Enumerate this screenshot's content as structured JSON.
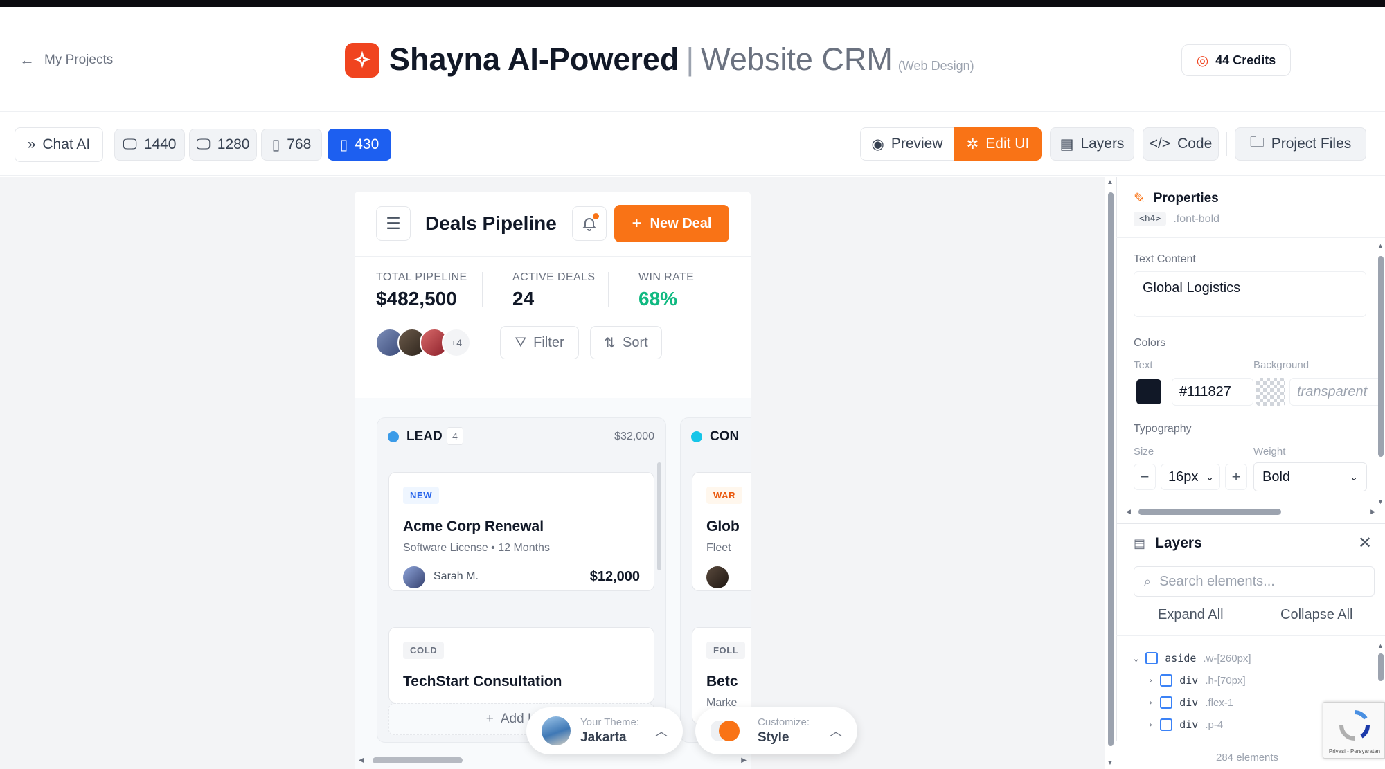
{
  "header": {
    "back_label": "My Projects",
    "title_main": "Shayna AI-Powered",
    "title_sep": "|",
    "title_sub": "Website CRM",
    "title_tag": "(Web Design)",
    "credits": "44 Credits"
  },
  "toolbar": {
    "chat": "Chat AI",
    "sizes": [
      "1440",
      "1280",
      "768",
      "430"
    ],
    "active_size": "430",
    "preview": "Preview",
    "edit": "Edit UI",
    "layers": "Layers",
    "code": "Code",
    "files": "Project Files"
  },
  "phone": {
    "title": "Deals Pipeline",
    "new_deal": "New Deal",
    "stats": [
      {
        "label": "TOTAL PIPELINE",
        "value": "$482,500"
      },
      {
        "label": "ACTIVE DEALS",
        "value": "24"
      },
      {
        "label": "WIN RATE",
        "value": "68%"
      }
    ],
    "avatars_more": "+4",
    "filter": "Filter",
    "sort": "Sort",
    "lead_col": {
      "name": "LEAD",
      "count": "4",
      "total": "$32,000"
    },
    "con_col": {
      "name": "CON"
    },
    "cards": [
      {
        "tag": "NEW",
        "title": "Acme Corp Renewal",
        "sub": "Software License • 12 Months",
        "owner": "Sarah M.",
        "value": "$12,000"
      },
      {
        "tag": "COLD",
        "title": "TechStart Consultation"
      }
    ],
    "con_cards": [
      {
        "tag": "WAR",
        "title": "Glob",
        "sub": "Fleet"
      },
      {
        "tag": "FOLL",
        "title": "Betc",
        "sub": "Marke"
      }
    ],
    "add_lead": "Add Lead"
  },
  "theme": {
    "label": "Your Theme:",
    "value": "Jakarta",
    "customize_label": "Customize:",
    "customize_value": "Style",
    "accent": "#f97316"
  },
  "properties": {
    "title": "Properties",
    "tag": "<h4>",
    "cls": ".font-bold",
    "text_content_label": "Text Content",
    "text_content": "Global Logistics",
    "colors_label": "Colors",
    "text_label": "Text",
    "text_color": "#111827",
    "bg_label": "Background",
    "bg_value": "transparent",
    "typography_label": "Typography",
    "size_label": "Size",
    "size_value": "16px",
    "weight_label": "Weight",
    "weight_value": "Bold"
  },
  "layers": {
    "title": "Layers",
    "search_placeholder": "Search elements...",
    "expand": "Expand All",
    "collapse": "Collapse All",
    "tree": [
      {
        "tag": "aside",
        "cls": ".w-[260px]"
      },
      {
        "tag": "div",
        "cls": ".h-[70px]"
      },
      {
        "tag": "div",
        "cls": ".flex-1"
      },
      {
        "tag": "div",
        "cls": ".p-4"
      }
    ],
    "count": "284 elements",
    "recaptcha": "Privasi - Persyaratan"
  }
}
